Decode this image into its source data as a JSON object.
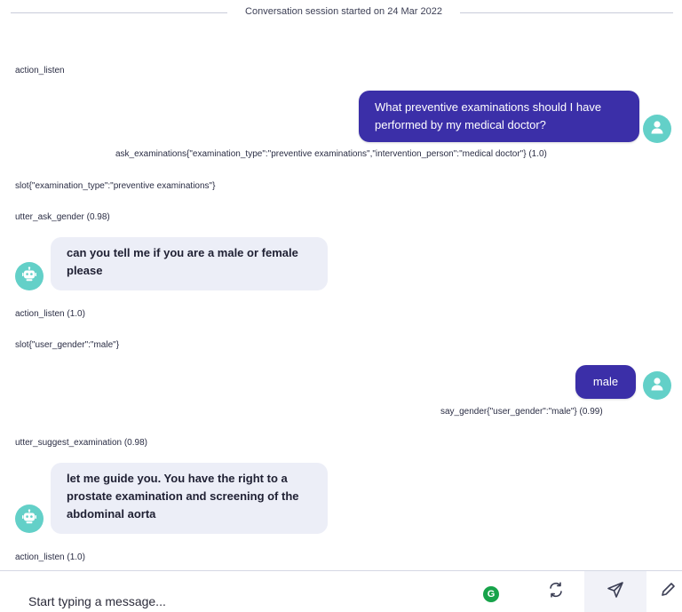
{
  "session": {
    "label": "Conversation session started on 24 Mar 2022"
  },
  "events": {
    "e1": "action_listen",
    "e2": "ask_examinations{\"examination_type\":\"preventive examinations\",\"intervention_person\":\"medical doctor\"} (1.0)",
    "e3": "slot{\"examination_type\":\"preventive examinations\"}",
    "e4": "utter_ask_gender (0.98)",
    "e5": "action_listen (1.0)",
    "e6": "slot{\"user_gender\":\"male\"}",
    "e7": "say_gender{\"user_gender\":\"male\"} (0.99)",
    "e8": "utter_suggest_examination (0.98)",
    "e9": "action_listen (1.0)"
  },
  "messages": {
    "user1": "What preventive examinations should I have performed by my medical doctor?",
    "bot1": "can you tell me if you are a male or female please",
    "user2": "male",
    "bot2": "let me guide you. You have the right to a prostate examination and screening of the abdominal aorta"
  },
  "composer": {
    "placeholder": "Start typing a message...",
    "grammar_badge": "G"
  },
  "icons": {
    "user_avatar": "user-icon",
    "bot_avatar": "robot-icon",
    "refresh": "refresh-icon",
    "send": "send-icon",
    "edit": "pen-icon"
  },
  "colors": {
    "user_bubble": "#3b2fa8",
    "bot_bubble": "#eceef7",
    "avatar": "#63d0c8",
    "grammar_badge": "#17a34a"
  }
}
